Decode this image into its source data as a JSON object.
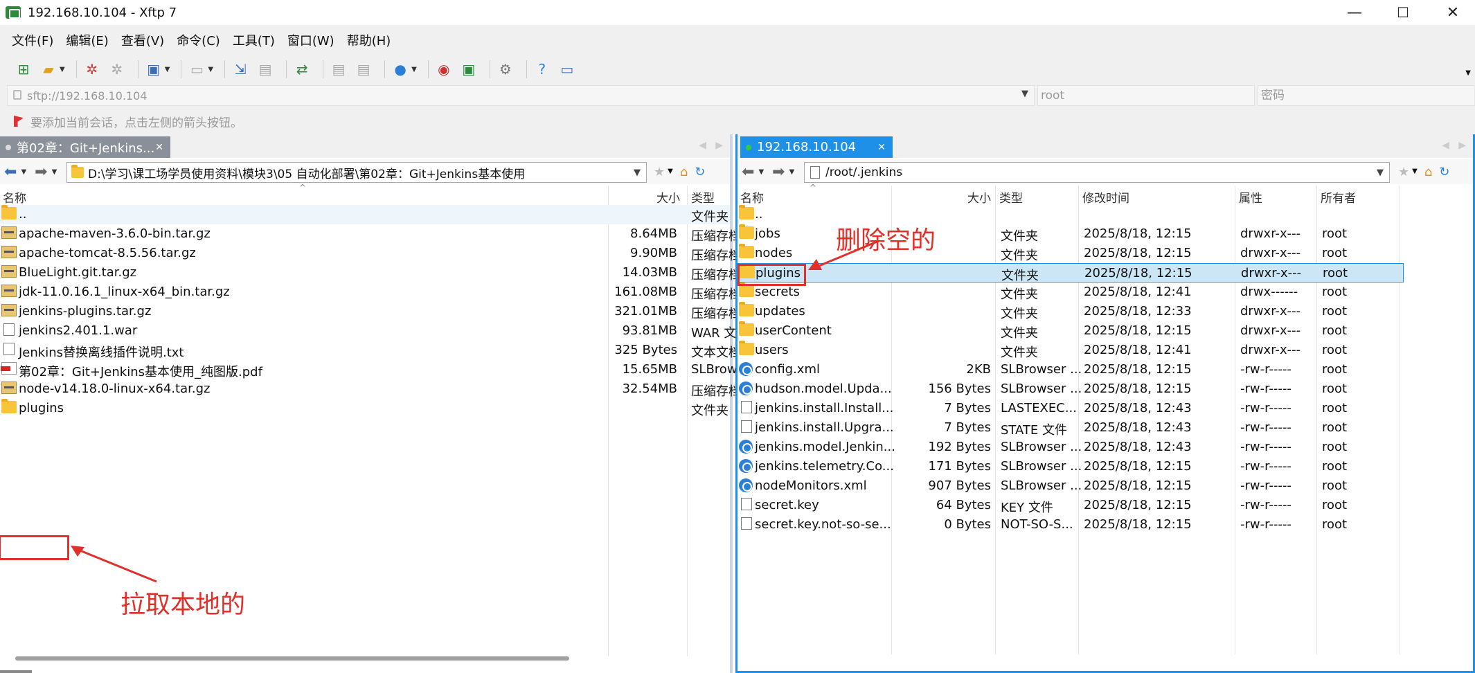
{
  "window": {
    "title": "192.168.10.104 - Xftp 7",
    "minimize": "—",
    "maximize": "☐",
    "close": "✕"
  },
  "menu": [
    "文件(F)",
    "编辑(E)",
    "查看(V)",
    "命令(C)",
    "工具(T)",
    "窗口(W)",
    "帮助(H)"
  ],
  "address": {
    "url": "sftp://192.168.10.104",
    "user_placeholder": "root",
    "password_placeholder": "密码"
  },
  "hint": "要添加当前会话，点击左侧的箭头按钮。",
  "left": {
    "tab_label": "第02章：Git+Jenkins...",
    "path": "D:\\学习\\课工场学员使用资料\\模块3\\05 自动化部署\\第02章：Git+Jenkins基本使用",
    "headers": {
      "name": "名称",
      "size": "大小",
      "type": "类型"
    },
    "rows": [
      {
        "name": "..",
        "size": "",
        "type": "文件夹",
        "icon": "folder-icon"
      },
      {
        "name": "apache-maven-3.6.0-bin.tar.gz",
        "size": "8.64MB",
        "type": "压缩存档",
        "icon": "archive-icon"
      },
      {
        "name": "apache-tomcat-8.5.56.tar.gz",
        "size": "9.90MB",
        "type": "压缩存档",
        "icon": "archive-icon"
      },
      {
        "name": "BlueLight.git.tar.gz",
        "size": "14.03MB",
        "type": "压缩存档",
        "icon": "archive-icon"
      },
      {
        "name": "jdk-11.0.16.1_linux-x64_bin.tar.gz",
        "size": "161.08MB",
        "type": "压缩存档",
        "icon": "archive-icon"
      },
      {
        "name": "jenkins-plugins.tar.gz",
        "size": "321.01MB",
        "type": "压缩存档",
        "icon": "archive-icon"
      },
      {
        "name": "jenkins2.401.1.war",
        "size": "93.81MB",
        "type": "WAR 文件",
        "icon": "file-icon"
      },
      {
        "name": "Jenkins替换离线插件说明.txt",
        "size": "325 Bytes",
        "type": "文本文档",
        "icon": "file-icon"
      },
      {
        "name": "第02章：Git+Jenkins基本使用_纯图版.pdf",
        "size": "15.65MB",
        "type": "SLBrowser",
        "icon": "pdf-icon"
      },
      {
        "name": "node-v14.18.0-linux-x64.tar.gz",
        "size": "32.54MB",
        "type": "压缩存档",
        "icon": "archive-icon"
      },
      {
        "name": "plugins",
        "size": "",
        "type": "文件夹",
        "icon": "folder-icon"
      }
    ],
    "annotation": "拉取本地的"
  },
  "right": {
    "tab_label": "192.168.10.104",
    "path": "/root/.jenkins",
    "headers": {
      "name": "名称",
      "size": "大小",
      "type": "类型",
      "mtime": "修改时间",
      "attr": "属性",
      "owner": "所有者"
    },
    "rows": [
      {
        "name": "..",
        "size": "",
        "type": "",
        "mtime": "",
        "attr": "",
        "owner": "",
        "icon": "folder-icon"
      },
      {
        "name": "jobs",
        "size": "",
        "type": "文件夹",
        "mtime": "2025/8/18, 12:15",
        "attr": "drwxr-x---",
        "owner": "root",
        "icon": "folder-icon"
      },
      {
        "name": "nodes",
        "size": "",
        "type": "文件夹",
        "mtime": "2025/8/18, 12:15",
        "attr": "drwxr-x---",
        "owner": "root",
        "icon": "folder-icon"
      },
      {
        "name": "plugins",
        "size": "",
        "type": "文件夹",
        "mtime": "2025/8/18, 12:15",
        "attr": "drwxr-x---",
        "owner": "root",
        "icon": "folder-icon"
      },
      {
        "name": "secrets",
        "size": "",
        "type": "文件夹",
        "mtime": "2025/8/18, 12:41",
        "attr": "drwx------",
        "owner": "root",
        "icon": "folder-icon"
      },
      {
        "name": "updates",
        "size": "",
        "type": "文件夹",
        "mtime": "2025/8/18, 12:33",
        "attr": "drwxr-x---",
        "owner": "root",
        "icon": "folder-icon"
      },
      {
        "name": "userContent",
        "size": "",
        "type": "文件夹",
        "mtime": "2025/8/18, 12:15",
        "attr": "drwxr-x---",
        "owner": "root",
        "icon": "folder-icon"
      },
      {
        "name": "users",
        "size": "",
        "type": "文件夹",
        "mtime": "2025/8/18, 12:41",
        "attr": "drwxr-x---",
        "owner": "root",
        "icon": "folder-icon"
      },
      {
        "name": "config.xml",
        "size": "2KB",
        "type": "SLBrowser ...",
        "mtime": "2025/8/18, 12:15",
        "attr": "-rw-r-----",
        "owner": "root",
        "icon": "browser-icon"
      },
      {
        "name": "hudson.model.Upda...",
        "size": "156 Bytes",
        "type": "SLBrowser ...",
        "mtime": "2025/8/18, 12:15",
        "attr": "-rw-r-----",
        "owner": "root",
        "icon": "browser-icon"
      },
      {
        "name": "jenkins.install.Install...",
        "size": "7 Bytes",
        "type": "LASTEXEC...",
        "mtime": "2025/8/18, 12:43",
        "attr": "-rw-r-----",
        "owner": "root",
        "icon": "file-icon"
      },
      {
        "name": "jenkins.install.Upgra...",
        "size": "7 Bytes",
        "type": "STATE 文件",
        "mtime": "2025/8/18, 12:43",
        "attr": "-rw-r-----",
        "owner": "root",
        "icon": "file-icon"
      },
      {
        "name": "jenkins.model.Jenkin...",
        "size": "192 Bytes",
        "type": "SLBrowser ...",
        "mtime": "2025/8/18, 12:43",
        "attr": "-rw-r-----",
        "owner": "root",
        "icon": "browser-icon"
      },
      {
        "name": "jenkins.telemetry.Co...",
        "size": "171 Bytes",
        "type": "SLBrowser ...",
        "mtime": "2025/8/18, 12:15",
        "attr": "-rw-r-----",
        "owner": "root",
        "icon": "browser-icon"
      },
      {
        "name": "nodeMonitors.xml",
        "size": "907 Bytes",
        "type": "SLBrowser ...",
        "mtime": "2025/8/18, 12:15",
        "attr": "-rw-r-----",
        "owner": "root",
        "icon": "browser-icon"
      },
      {
        "name": "secret.key",
        "size": "64 Bytes",
        "type": "KEY 文件",
        "mtime": "2025/8/18, 12:15",
        "attr": "-rw-r-----",
        "owner": "root",
        "icon": "file-icon"
      },
      {
        "name": "secret.key.not-so-se...",
        "size": "0 Bytes",
        "type": "NOT-SO-S...",
        "mtime": "2025/8/18, 12:15",
        "attr": "-rw-r-----",
        "owner": "root",
        "icon": "file-icon"
      }
    ],
    "annotation": "删除空的"
  },
  "colors": {
    "accent": "#1e90e8",
    "annotation": "#e0302a",
    "selection": "#cce6f6"
  }
}
